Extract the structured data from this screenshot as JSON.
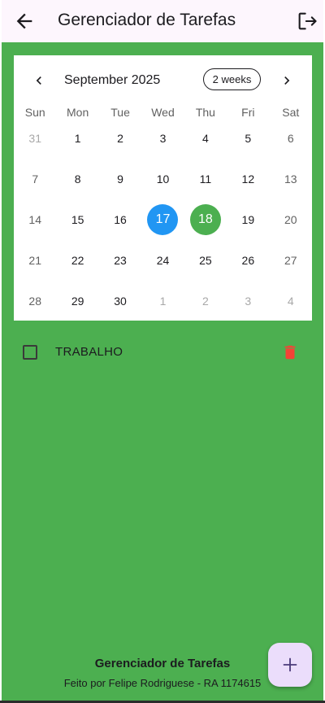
{
  "appbar": {
    "title": "Gerenciador de Tarefas",
    "back_icon": "arrow-left-icon",
    "logout_icon": "logout-icon"
  },
  "calendar": {
    "month_label": "September 2025",
    "format_button": "2 weeks",
    "days_of_week": [
      "Sun",
      "Mon",
      "Tue",
      "Wed",
      "Thu",
      "Fri",
      "Sat"
    ],
    "weeks": [
      [
        "31",
        "1",
        "2",
        "3",
        "4",
        "5",
        "6"
      ],
      [
        "7",
        "8",
        "9",
        "10",
        "11",
        "12",
        "13"
      ],
      [
        "14",
        "15",
        "16",
        "17",
        "18",
        "19",
        "20"
      ],
      [
        "21",
        "22",
        "23",
        "24",
        "25",
        "26",
        "27"
      ],
      [
        "28",
        "29",
        "30",
        "1",
        "2",
        "3",
        "4"
      ]
    ],
    "selected_day": "17",
    "today": "18",
    "colors": {
      "selected": "#2196f3",
      "today": "#4caf50"
    }
  },
  "tasks": [
    {
      "label": "TRABALHO",
      "checked": false
    }
  ],
  "footer": {
    "title": "Gerenciador de Tarefas",
    "credit": "Feito por Felipe Rodriguese - RA 1174615"
  },
  "fab": {
    "icon": "plus-icon"
  },
  "colors": {
    "background": "#4caf50",
    "appbar": "#fdf6fd",
    "fab": "#ebddfb",
    "delete": "#f44336"
  }
}
